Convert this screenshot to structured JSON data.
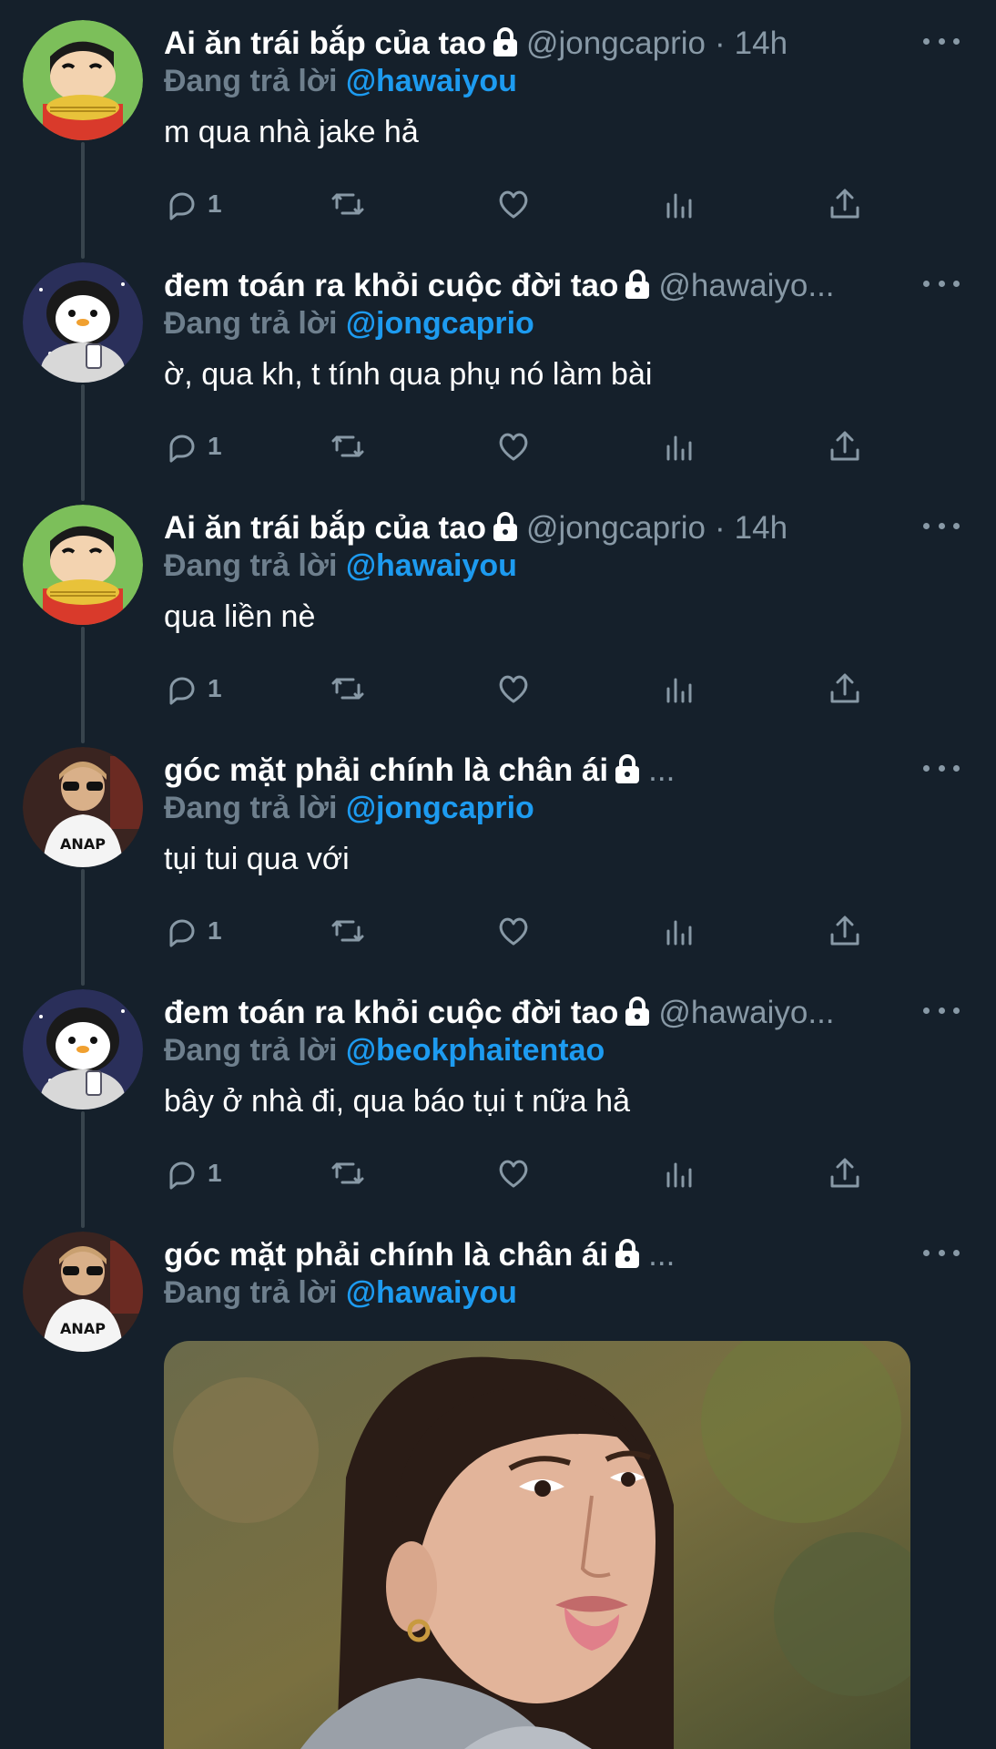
{
  "colors": {
    "background": "#15202b",
    "secondary_text": "#8899a6",
    "reply_prefix": "#6e7f8d",
    "mention": "#1d9bf0",
    "thread_line": "#38444d"
  },
  "tweets": [
    {
      "display_name": "Ai ăn trái bắp của tao",
      "handle": "@jongcaprio",
      "dot": "·",
      "time": "14h",
      "reply_prefix": "Đang trả lời",
      "reply_handle": "@hawaiyou",
      "text": "m qua nhà jake hả",
      "reply_count": "1",
      "avatar_icon": "shinchan-avatar"
    },
    {
      "display_name": "đem toán ra khỏi cuộc đời tao",
      "handle": "@hawaiyo...",
      "dot": "",
      "time": "",
      "reply_prefix": "Đang trả lời",
      "reply_handle": "@jongcaprio",
      "text": "ờ, qua kh, t tính qua phụ nó làm bài",
      "reply_count": "1",
      "avatar_icon": "penguin-avatar"
    },
    {
      "display_name": "Ai ăn trái bắp của tao",
      "handle": "@jongcaprio",
      "dot": "·",
      "time": "14h",
      "reply_prefix": "Đang trả lời",
      "reply_handle": "@hawaiyou",
      "text": "qua liền nè",
      "reply_count": "1",
      "avatar_icon": "shinchan-avatar"
    },
    {
      "display_name": "góc mặt phải chính là chân ái",
      "handle": "...",
      "dot": "",
      "time": "",
      "reply_prefix": "Đang trả lời",
      "reply_handle": "@jongcaprio",
      "text": "tụi tui qua với",
      "reply_count": "1",
      "avatar_icon": "child-photo-avatar"
    },
    {
      "display_name": "đem toán ra khỏi cuộc đời tao",
      "handle": "@hawaiyo...",
      "dot": "",
      "time": "",
      "reply_prefix": "Đang trả lời",
      "reply_handle": "@beokphaitentao",
      "text": "bây ở nhà đi, qua báo tụi t nữa hả",
      "reply_count": "1",
      "avatar_icon": "penguin-avatar"
    },
    {
      "display_name": "góc mặt phải chính là chân ái",
      "handle": "...",
      "dot": "",
      "time": "",
      "reply_prefix": "Đang trả lời",
      "reply_handle": "@hawaiyou",
      "text": "",
      "reply_count": "",
      "avatar_icon": "child-photo-avatar",
      "media": "woman-tongue-out-photo"
    }
  ],
  "avatar_text": {
    "anap": "ANAP"
  },
  "icons": [
    "reply-icon",
    "retweet-icon",
    "like-icon",
    "analytics-icon",
    "share-icon",
    "more-icon",
    "lock-icon"
  ]
}
